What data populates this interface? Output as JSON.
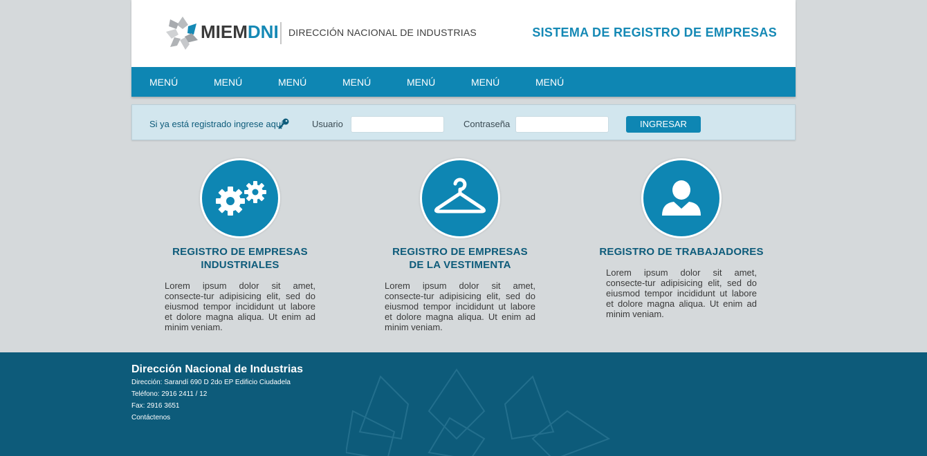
{
  "header": {
    "brand_part1": "MIEM",
    "brand_part2": "DNI",
    "department": "DIRECCIÓN NACIONAL DE INDUSTRIAS",
    "system_title": "SISTEMA DE REGISTRO DE EMPRESAS",
    "logo_icon": "star-logo-icon"
  },
  "nav": {
    "items": [
      "MENÚ",
      "MENÚ",
      "MENÚ",
      "MENÚ",
      "MENÚ",
      "MENÚ",
      "MENÚ"
    ]
  },
  "login": {
    "prompt": "Si ya está registrado ingrese aquí",
    "prompt_icon": "key-icon",
    "user_label": "Usuario",
    "user_value": "",
    "password_label": "Contraseña",
    "password_value": "",
    "submit_label": "INGRESAR"
  },
  "cards": [
    {
      "icon": "gears-icon",
      "title_line1": "REGISTRO DE EMPRESAS",
      "title_line2": "INDUSTRIALES",
      "text": "Lorem ipsum dolor sit amet, consecte-tur adipisicing elit, sed do eiusmod tempor incididunt ut labore et dolore magna aliqua. Ut enim ad minim veniam."
    },
    {
      "icon": "hanger-icon",
      "title_line1": "REGISTRO DE EMPRESAS",
      "title_line2": "DE LA VESTIMENTA",
      "text": "Lorem ipsum dolor sit amet, consecte-tur adipisicing elit, sed do eiusmod tempor incididunt ut labore et dolore magna aliqua. Ut enim ad minim veniam."
    },
    {
      "icon": "user-icon",
      "title_line1": "REGISTRO DE TRABAJADORES",
      "title_line2": "",
      "text": "Lorem ipsum dolor sit amet, consecte-tur adipisicing elit, sed do eiusmod tempor incididunt ut labore et dolore magna aliqua. Ut enim ad minim veniam."
    }
  ],
  "footer": {
    "title": "Dirección Nacional de Industrias",
    "address": "Dirección: Sarandí 690 D 2do EP Edificio Ciudadela",
    "phone": "Teléfono: 2916 2411 / 12",
    "fax": "Fax: 2916 3651",
    "contact": "Contáctenos"
  },
  "colors": {
    "accent": "#0e86b3",
    "dark": "#0d5b7a",
    "background": "#d5d9db",
    "login_bar": "#d2e6ee"
  }
}
